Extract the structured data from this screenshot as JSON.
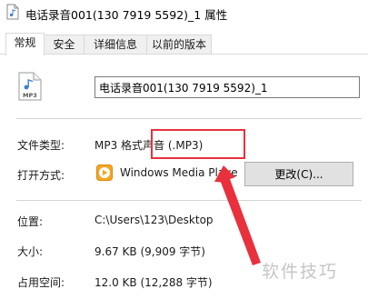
{
  "window": {
    "title": "电话录音001(130 7919 5592)_1 属性"
  },
  "tabs": [
    {
      "label": "常规",
      "active": true
    },
    {
      "label": "安全",
      "active": false
    },
    {
      "label": "详细信息",
      "active": false
    },
    {
      "label": "以前的版本",
      "active": false
    }
  ],
  "general": {
    "file_name": "电话录音001(130 7919 5592)_1",
    "file_type_label": "文件类型:",
    "file_type_value": "MP3 格式声音 (.MP3)",
    "opens_with_label": "打开方式:",
    "opens_with_app": "Windows Media Playe",
    "change_button": "更改(C)...",
    "location_label": "位置:",
    "location_value": "C:\\Users\\123\\Desktop",
    "size_label": "大小:",
    "size_value": "9.67 KB (9,909 字节)",
    "size_on_disk_label": "占用空间:",
    "size_on_disk_value": "12.0 KB (12,288 字节)"
  },
  "watermark": "软件技巧",
  "icons": {
    "title": "mp3-file-icon",
    "file": "mp3-file-icon",
    "app": "windows-media-player-icon"
  },
  "colors": {
    "highlight": "#e8313c",
    "app_icon": "#f5a623"
  }
}
